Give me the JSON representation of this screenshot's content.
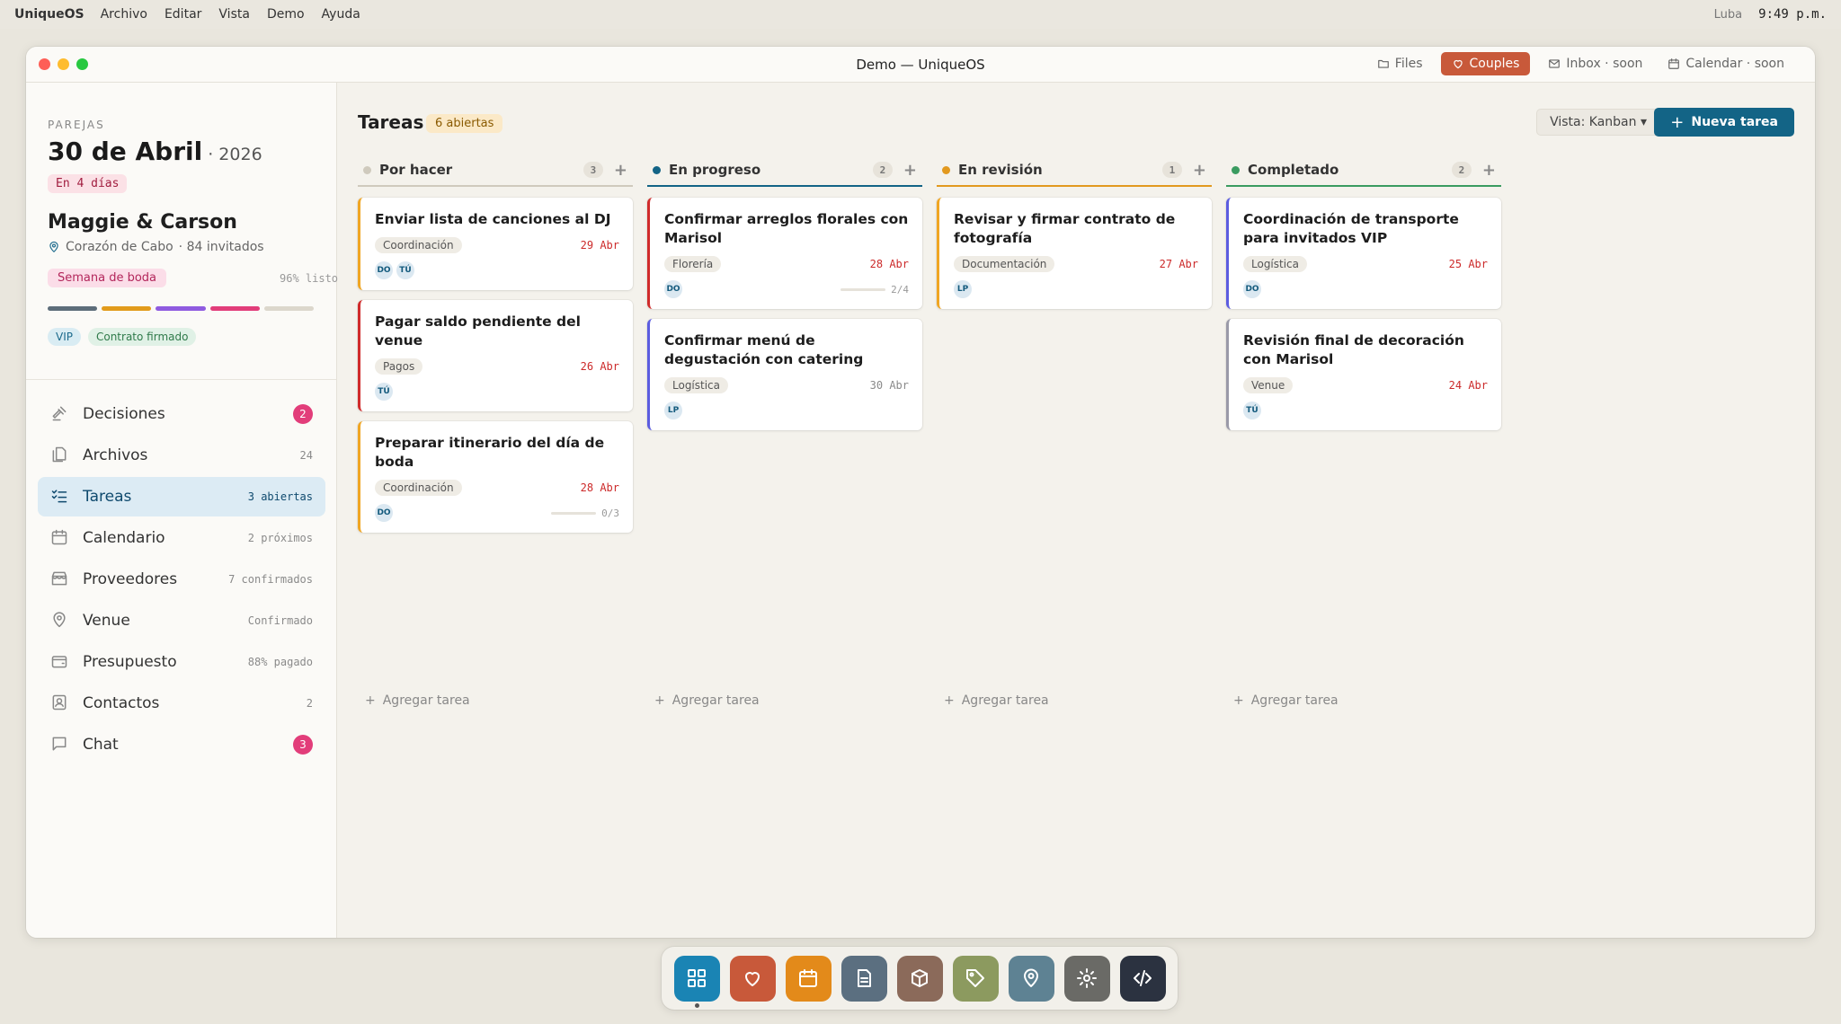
{
  "menubar": {
    "app_name": "UniqueOS",
    "items": [
      "Archivo",
      "Editar",
      "Vista",
      "Demo",
      "Ayuda"
    ],
    "user": "Luba",
    "clock": "9:49 p.m."
  },
  "window": {
    "title": "Demo — UniqueOS",
    "toolbar": [
      {
        "label": "Files",
        "icon": "folder-icon",
        "active": false
      },
      {
        "label": "Couples",
        "icon": "heart-icon",
        "active": true
      },
      {
        "label": "Inbox · soon",
        "icon": "mail-icon",
        "active": false
      },
      {
        "label": "Calendar · soon",
        "icon": "calendar-icon",
        "active": false
      }
    ]
  },
  "sidebar": {
    "eyebrow": "PAREJAS",
    "date": "30 de Abril",
    "year": "· 2026",
    "countdown": "En 4 días",
    "couple": "Maggie & Carson",
    "venue": "Corazón de Cabo",
    "guests": "· 84 invitados",
    "phase": "Semana de boda",
    "ready": "96% listo",
    "progress_colors": [
      "#5d6d7a",
      "#e29b1c",
      "#8f5be0",
      "#e23d7a",
      "#dcd7cc"
    ],
    "tags": [
      {
        "label": "VIP",
        "bg": "#d9ecf3",
        "fg": "#1b6a8c"
      },
      {
        "label": "Contrato firmado",
        "bg": "#e0f1e6",
        "fg": "#2f7a4a"
      }
    ],
    "nav": [
      {
        "label": "Decisiones",
        "icon": "gavel-icon",
        "meta": "2",
        "badge": true,
        "active": false
      },
      {
        "label": "Archivos",
        "icon": "files-icon",
        "meta": "24",
        "badge": false,
        "active": false
      },
      {
        "label": "Tareas",
        "icon": "checklist-icon",
        "meta": "3 abiertas",
        "badge": false,
        "active": true
      },
      {
        "label": "Calendario",
        "icon": "calendar-icon",
        "meta": "2 próximos",
        "badge": false,
        "active": false
      },
      {
        "label": "Proveedores",
        "icon": "store-icon",
        "meta": "7 confirmados",
        "badge": false,
        "active": false
      },
      {
        "label": "Venue",
        "icon": "map-pin-icon",
        "meta": "Confirmado",
        "badge": false,
        "active": false
      },
      {
        "label": "Presupuesto",
        "icon": "wallet-icon",
        "meta": "88% pagado",
        "badge": false,
        "active": false
      },
      {
        "label": "Contactos",
        "icon": "contacts-icon",
        "meta": "2",
        "badge": false,
        "active": false
      },
      {
        "label": "Chat",
        "icon": "chat-icon",
        "meta": "3",
        "badge": true,
        "active": false
      }
    ]
  },
  "main": {
    "title": "Tareas",
    "count": "6 abiertas",
    "view_label": "Vista: Kanban ▾",
    "new_label": "Nueva tarea",
    "add_task_label": "Agregar tarea",
    "columns": [
      {
        "name": "Por hacer",
        "count": "3",
        "color": "#cfcabd",
        "cards": [
          {
            "title": "Enviar lista de canciones al DJ",
            "tag": "Coordinación",
            "due": "29 Abr",
            "due_color": "#cc2a2a",
            "accent": "#f0a623",
            "avatars": [
              "DO",
              "TÚ"
            ],
            "progress": null
          },
          {
            "title": "Pagar saldo pendiente del venue",
            "tag": "Pagos",
            "due": "26 Abr",
            "due_color": "#cc2a2a",
            "accent": "#d02b2b",
            "avatars": [
              "TÚ"
            ],
            "progress": null
          },
          {
            "title": "Preparar itinerario del día de boda",
            "tag": "Coordinación",
            "due": "28 Abr",
            "due_color": "#cc2a2a",
            "accent": "#f0a623",
            "avatars": [
              "DO"
            ],
            "progress": "0/3"
          }
        ]
      },
      {
        "name": "En progreso",
        "count": "2",
        "color": "#136486",
        "cards": [
          {
            "title": "Confirmar arreglos florales con Marisol",
            "tag": "Florería",
            "due": "28 Abr",
            "due_color": "#cc2a2a",
            "accent": "#d02b2b",
            "avatars": [
              "DO"
            ],
            "progress": "2/4"
          },
          {
            "title": "Confirmar menú de degustación con catering",
            "tag": "Logística",
            "due": "30 Abr",
            "due_color": "#8a8a8a",
            "accent": "#5b5ce0",
            "avatars": [
              "LP"
            ],
            "progress": null
          }
        ]
      },
      {
        "name": "En revisión",
        "count": "1",
        "color": "#e2991f",
        "cards": [
          {
            "title": "Revisar y firmar contrato de fotografía",
            "tag": "Documentación",
            "due": "27 Abr",
            "due_color": "#cc2a2a",
            "accent": "#f0a623",
            "avatars": [
              "LP"
            ],
            "progress": null
          }
        ]
      },
      {
        "name": "Completado",
        "count": "2",
        "color": "#3a9b60",
        "cards": [
          {
            "title": "Coordinación de transporte para invitados VIP",
            "tag": "Logística",
            "due": "25 Abr",
            "due_color": "#cc2a2a",
            "accent": "#5b5ce0",
            "avatars": [
              "DO"
            ],
            "progress": null
          },
          {
            "title": "Revisión final de decoración con Marisol",
            "tag": "Venue",
            "due": "24 Abr",
            "due_color": "#cc2a2a",
            "accent": "#9a9aa8",
            "avatars": [
              "TÚ"
            ],
            "progress": null
          }
        ]
      }
    ]
  },
  "dock": [
    {
      "name": "apps-icon",
      "bg": "#1a84b4",
      "running": true
    },
    {
      "name": "heart-icon",
      "bg": "#c8593a",
      "running": false
    },
    {
      "name": "calendar-icon",
      "bg": "#e38a1a",
      "running": false
    },
    {
      "name": "document-icon",
      "bg": "#5b6f80",
      "running": false
    },
    {
      "name": "box-icon",
      "bg": "#8b6a5a",
      "running": false
    },
    {
      "name": "tag-icon",
      "bg": "#8c9a5f",
      "running": false
    },
    {
      "name": "map-pin-icon",
      "bg": "#5e8293",
      "running": false
    },
    {
      "name": "settings-icon",
      "bg": "#6a6a66",
      "running": false
    },
    {
      "name": "code-icon",
      "bg": "#2b3240",
      "running": false
    }
  ]
}
